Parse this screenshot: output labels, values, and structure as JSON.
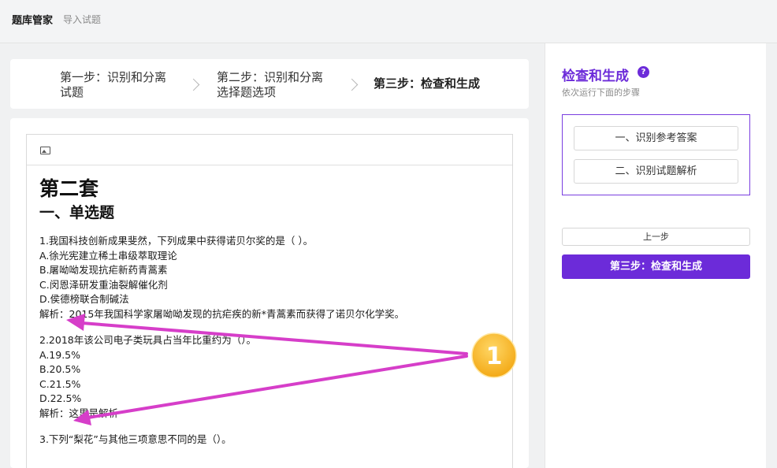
{
  "topbar": {
    "title": "题库管家",
    "subtitle": "导入试题"
  },
  "steps": [
    {
      "line1": "第一步：识别和分离",
      "line2": "试题"
    },
    {
      "line1": "第二步：识别和分离",
      "line2": "选择题选项"
    },
    {
      "line1": "第三步：检查和生成",
      "line2": ""
    }
  ],
  "document": {
    "title": "第二套",
    "section": "一、单选题",
    "questions": [
      {
        "lines": [
          "1.我国科技创新成果斐然，下列成果中获得诺贝尔奖的是（   ）。",
          "A.徐光宪建立稀土串级萃取理论",
          "B.屠呦呦发现抗疟新药青蒿素",
          "C.闵恩泽研发重油裂解催化剂",
          "D.侯德榜联合制碱法",
          "解析：2015年我国科学家屠呦呦发现的抗疟疾的新*青蒿素而获得了诺贝尔化学奖。"
        ]
      },
      {
        "lines": [
          "2.2018年该公司电子类玩具占当年比重约为（）。",
          "A.19.5%",
          "B.20.5%",
          "C.21.5%",
          "D.22.5%",
          "解析：这里是解析"
        ]
      },
      {
        "lines": [
          "3.下列“梨花”与其他三项意思不同的是（）。"
        ]
      }
    ]
  },
  "panel": {
    "title": "检查和生成",
    "subtitle": "依次运行下面的步骤",
    "sub_steps": [
      "一、识别参考答案",
      "二、识别试题解析"
    ],
    "prev_label": "上一步",
    "primary_label": "第三步：检查和生成"
  },
  "annotation": {
    "badge": "1",
    "arrow_color": "#d63ec9",
    "badge_color": "#f5b623"
  },
  "colors": {
    "accent": "#6c2bd9"
  }
}
